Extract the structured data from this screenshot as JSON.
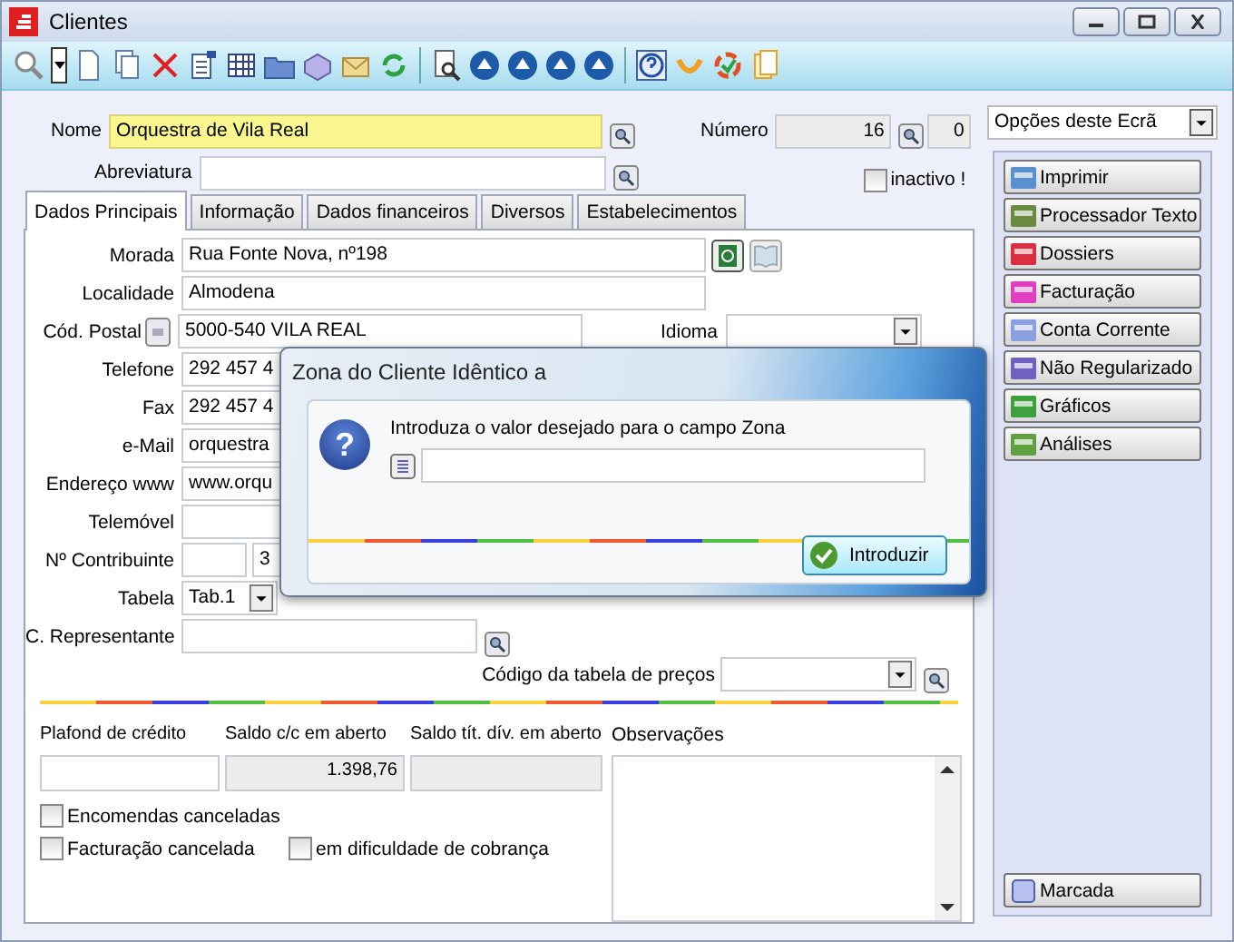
{
  "window": {
    "title": "Clientes"
  },
  "header": {
    "name": {
      "label": "Nome",
      "value": "Orquestra de Vila Real"
    },
    "short_name": {
      "label": "Abreviatura"
    },
    "number": {
      "label": "Número",
      "value": "16",
      "suffix": "0"
    },
    "inactive": {
      "label": "inactivo !",
      "checked": false
    }
  },
  "tabs": [
    {
      "label": "Dados Principais",
      "selected": true
    },
    {
      "label": "Informação",
      "selected": false
    },
    {
      "label": "Dados financeiros",
      "selected": false
    },
    {
      "label": "Diversos",
      "selected": false
    },
    {
      "label": "Estabelecimentos",
      "selected": false
    }
  ],
  "fields": [
    {
      "kind": "address",
      "label": "Morada",
      "value": "Rua Fonte Nova, nº198"
    },
    {
      "kind": "text",
      "label": "Localidade",
      "value": "Almodena"
    },
    {
      "kind": "postal",
      "label": "Cód. Postal",
      "value": "5000-540 VILA REAL",
      "side_label": "Idioma"
    },
    {
      "kind": "text",
      "label": "Telefone",
      "value": "292 457 4"
    },
    {
      "kind": "text",
      "label": "Fax",
      "value": "292 457 4"
    },
    {
      "kind": "text",
      "label": "e-Mail",
      "value": "orquestra"
    },
    {
      "kind": "text",
      "label": "Endereço www",
      "value": "www.orqu"
    },
    {
      "kind": "text",
      "label": "Telemóvel"
    },
    {
      "kind": "split",
      "label": "Nº Contribuinte",
      "value": "3"
    },
    {
      "kind": "select",
      "label": "Tabela",
      "value": "Tab.1"
    },
    {
      "kind": "lookup",
      "label": "C. Representante"
    },
    {
      "kind": "price",
      "label": "Código da tabela de preços"
    }
  ],
  "balances": [
    {
      "label": "Plafond de crédito",
      "disabled": false
    },
    {
      "label": "Saldo c/c em aberto",
      "value": "1.398,76",
      "disabled": true
    },
    {
      "label": "Saldo tít. dív. em aberto",
      "disabled": true
    }
  ],
  "notes": {
    "label": "Observações"
  },
  "flags": [
    {
      "label": "Encomendas canceladas",
      "checked": false
    },
    {
      "label": "Facturação cancelada",
      "checked": false
    },
    {
      "label": "em dificuldade de cobrança",
      "checked": false
    }
  ],
  "options": {
    "value": "Opções deste Ecrã"
  },
  "actions": [
    {
      "label": "Imprimir"
    },
    {
      "label": "Processador Texto"
    },
    {
      "label": "Dossiers"
    },
    {
      "label": "Facturação"
    },
    {
      "label": "Conta Corrente"
    },
    {
      "label": "Não Regularizado"
    },
    {
      "label": "Gráficos"
    },
    {
      "label": "Análises"
    }
  ],
  "marked": {
    "label": "Marcada"
  },
  "dialog": {
    "icon": "?",
    "title": "Zona do Cliente Idêntico a",
    "prompt": "Introduza o valor desejado para o campo Zona",
    "button": "Introduzir"
  }
}
